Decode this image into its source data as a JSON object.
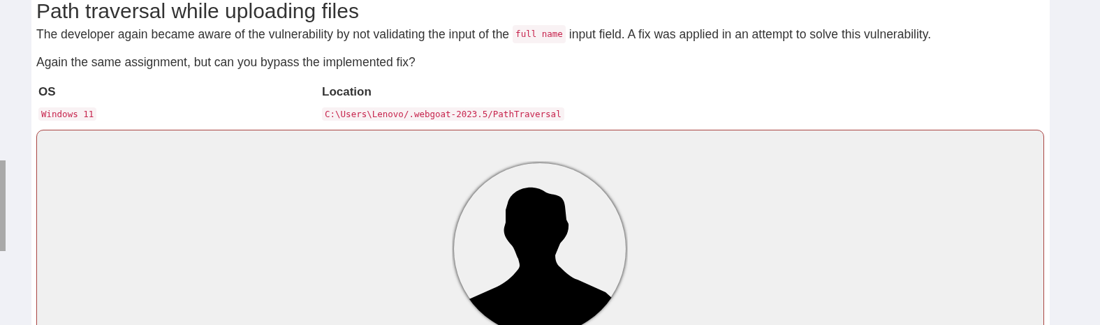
{
  "heading": "Path traversal while uploading files",
  "paragraphs": [
    [
      {
        "kind": "text",
        "text": "The developer again became aware of the vulnerability by not validating the input of the"
      },
      {
        "kind": "code",
        "text": "full name"
      },
      {
        "kind": "text",
        "text": "input field. A fix was applied in an attempt to solve this vulnerability."
      }
    ],
    [
      {
        "kind": "text",
        "text": "Again the same assignment, but can you bypass the implemented fix?"
      }
    ]
  ],
  "table": {
    "columns": [
      "OS",
      "Location"
    ],
    "rows": [
      [
        "Windows 11",
        "C:\\Users\\Lenovo/.webgoat-2023.5/PathTraversal"
      ]
    ]
  },
  "upload_card": {
    "avatar": {
      "kind": "silhouette"
    }
  }
}
